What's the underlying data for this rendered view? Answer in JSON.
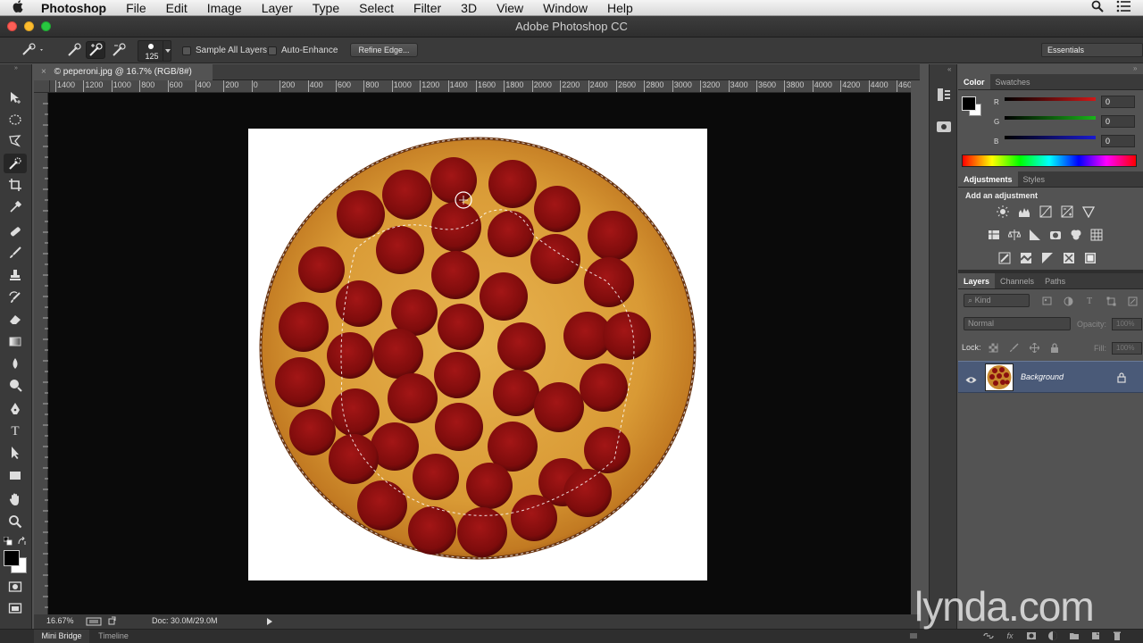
{
  "menubar": {
    "app": "Photoshop",
    "items": [
      "File",
      "Edit",
      "Image",
      "Layer",
      "Type",
      "Select",
      "Filter",
      "3D",
      "View",
      "Window",
      "Help"
    ]
  },
  "window": {
    "title": "Adobe Photoshop CC"
  },
  "options": {
    "brush_size": "125",
    "sample_all_layers": "Sample All Layers",
    "auto_enhance": "Auto-Enhance",
    "refine_edge": "Refine Edge...",
    "workspace": "Essentials"
  },
  "document": {
    "tab_label": "© peperoni.jpg @ 16.7% (RGB/8#)",
    "ruler_ticks": [
      "1400",
      "1200",
      "1000",
      "800",
      "600",
      "400",
      "200",
      "0",
      "200",
      "400",
      "600",
      "800",
      "1000",
      "1200",
      "1400",
      "1600",
      "1800",
      "2000",
      "2200",
      "2400",
      "2600",
      "2800",
      "3000",
      "3200",
      "3400",
      "3600",
      "3800",
      "4000",
      "4200",
      "4400",
      "460"
    ]
  },
  "status": {
    "zoom": "16.67%",
    "doc_size": "Doc: 30.0M/29.0M"
  },
  "bottom": {
    "tabs": [
      "Mini Bridge",
      "Timeline"
    ]
  },
  "color_panel": {
    "tabs": [
      "Color",
      "Swatches"
    ],
    "r_label": "R",
    "g_label": "G",
    "b_label": "B",
    "r_value": "0",
    "g_value": "0",
    "b_value": "0",
    "colors": {
      "r": "#d01818",
      "g": "#19b419",
      "b": "#1a1ad0"
    }
  },
  "adjustments_panel": {
    "tabs": [
      "Adjustments",
      "Styles"
    ],
    "heading": "Add an adjustment"
  },
  "layers_panel": {
    "tabs": [
      "Layers",
      "Channels",
      "Paths"
    ],
    "kind": "Kind",
    "blend_mode": "Normal",
    "opacity_label": "Opacity:",
    "opacity_value": "100%",
    "lock_label": "Lock:",
    "fill_label": "Fill:",
    "fill_value": "100%",
    "layer_name": "Background"
  },
  "watermark": "lynda.com"
}
